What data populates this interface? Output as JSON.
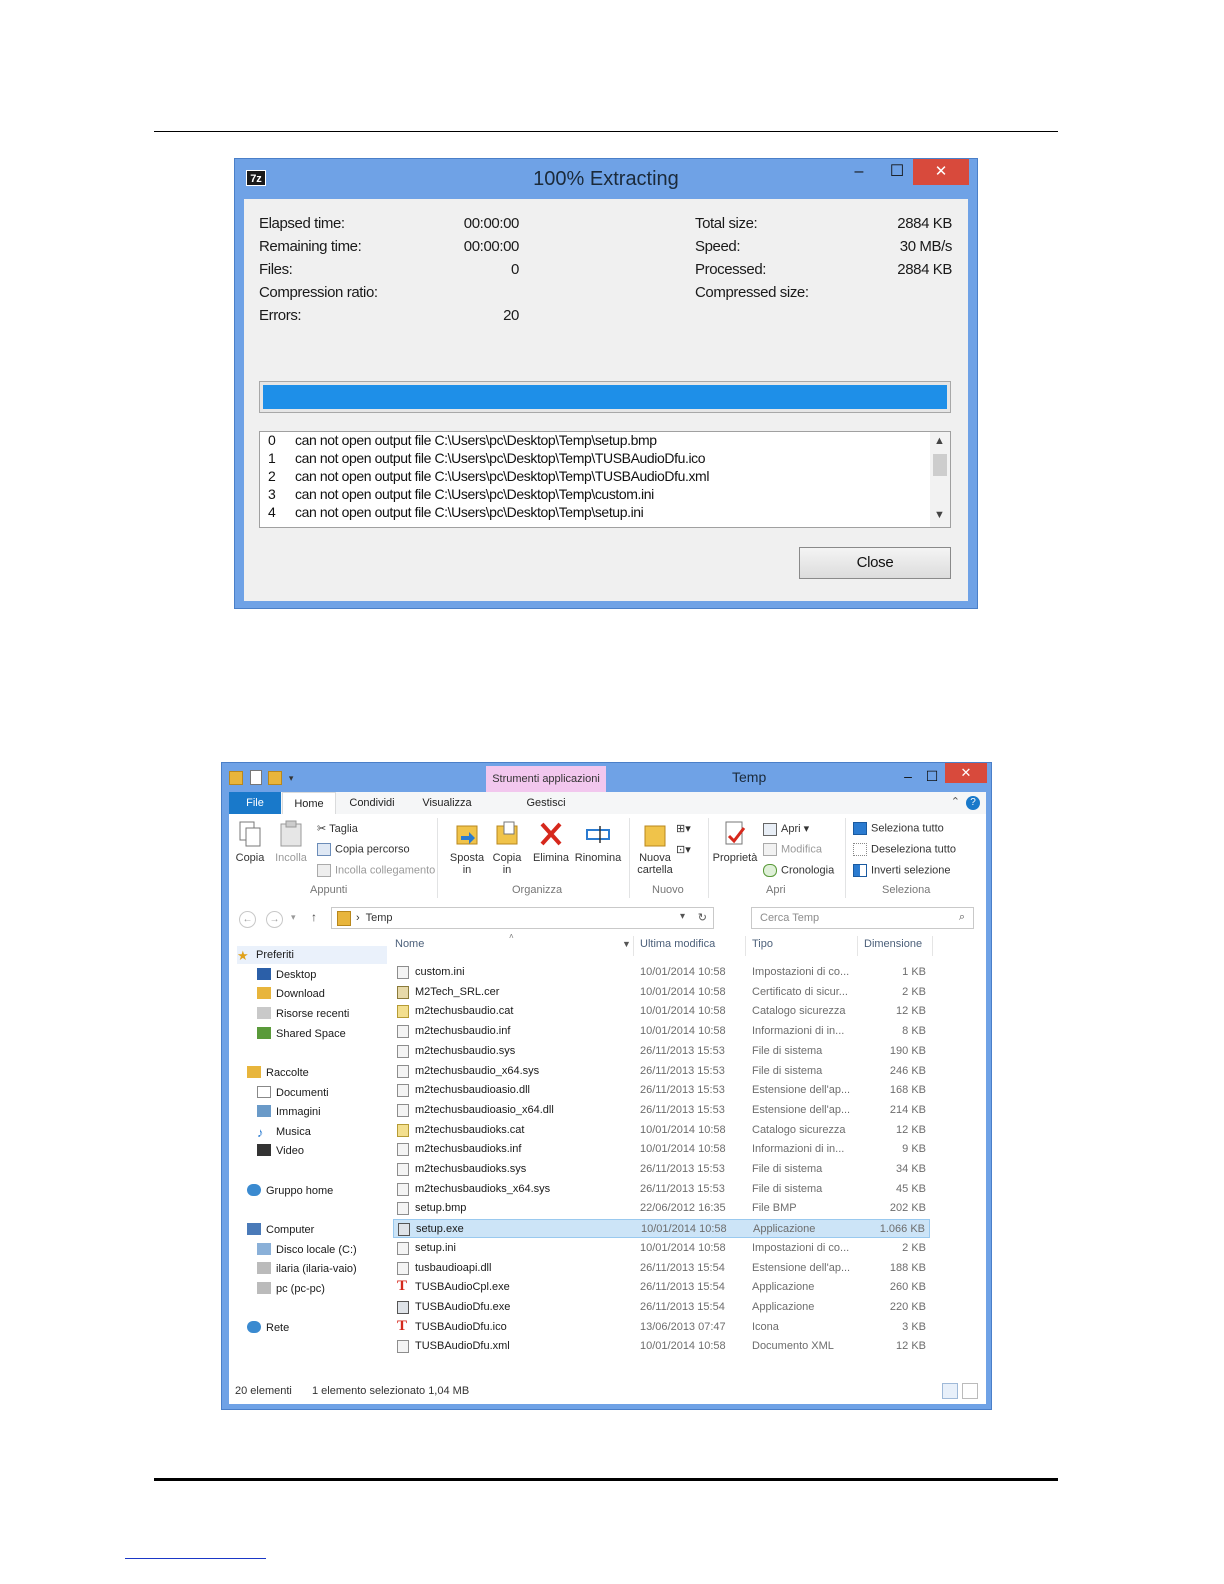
{
  "zip": {
    "icon_text": "7z",
    "title": "100% Extracting",
    "controls": {
      "minimize": "–",
      "maximize": "☐",
      "close": "✕"
    },
    "left_stats": [
      {
        "label": "Elapsed time:",
        "value": "00:00:00"
      },
      {
        "label": "Remaining time:",
        "value": "00:00:00"
      },
      {
        "label": "Files:",
        "value": "0"
      },
      {
        "label": "Compression ratio:",
        "value": ""
      },
      {
        "label": "Errors:",
        "value": "20"
      }
    ],
    "right_stats": [
      {
        "label": "Total size:",
        "value": "2884 KB"
      },
      {
        "label": "Speed:",
        "value": "30 MB/s"
      },
      {
        "label": "Processed:",
        "value": "2884 KB"
      },
      {
        "label": "Compressed size:",
        "value": ""
      }
    ],
    "progress_fraction": 1.0,
    "errors": [
      {
        "index": "0",
        "message": "can not open output file C:\\Users\\pc\\Desktop\\Temp\\setup.bmp"
      },
      {
        "index": "1",
        "message": "can not open output file C:\\Users\\pc\\Desktop\\Temp\\TUSBAudioDfu.ico"
      },
      {
        "index": "2",
        "message": "can not open output file C:\\Users\\pc\\Desktop\\Temp\\TUSBAudioDfu.xml"
      },
      {
        "index": "3",
        "message": "can not open output file C:\\Users\\pc\\Desktop\\Temp\\custom.ini"
      },
      {
        "index": "4",
        "message": "can not open output file C:\\Users\\pc\\Desktop\\Temp\\setup.ini"
      }
    ],
    "close_label": "Close"
  },
  "explorer": {
    "context_tab": "Strumenti applicazioni",
    "title": "Temp",
    "tabs": [
      "File",
      "Home",
      "Condividi",
      "Visualizza",
      "Gestisci"
    ],
    "ribbon": {
      "copia": "Copia",
      "incolla": "Incolla",
      "taglia": "Taglia",
      "copia_percorso": "Copia percorso",
      "incolla_collegamento": "Incolla collegamento",
      "group_appunti": "Appunti",
      "sposta_in": "Sposta in",
      "copia_in": "Copia in",
      "elimina": "Elimina",
      "rinomina": "Rinomina",
      "group_organizza": "Organizza",
      "nuova_cartella": "Nuova cartella",
      "group_nuovo": "Nuovo",
      "proprieta": "Proprietà",
      "apri": "Apri",
      "modifica": "Modifica",
      "cronologia": "Cronologia",
      "group_apri": "Apri",
      "seleziona_tutto": "Seleziona tutto",
      "deseleziona_tutto": "Deseleziona tutto",
      "inverti_selezione": "Inverti selezione",
      "group_seleziona": "Seleziona"
    },
    "address": "Temp",
    "search_placeholder": "Cerca Temp",
    "nav": {
      "preferiti": "Preferiti",
      "desktop": "Desktop",
      "download": "Download",
      "risorse_recenti": "Risorse recenti",
      "shared_space": "Shared Space",
      "raccolte": "Raccolte",
      "documenti": "Documenti",
      "immagini": "Immagini",
      "musica": "Musica",
      "video": "Video",
      "gruppo_home": "Gruppo home",
      "computer": "Computer",
      "disco_locale": "Disco locale (C:)",
      "ilaria": "ilaria (ilaria-vaio)",
      "pc": "pc (pc-pc)",
      "rete": "Rete"
    },
    "columns": {
      "name": "Nome",
      "modified": "Ultima modifica",
      "type": "Tipo",
      "size": "Dimensione"
    },
    "files": [
      {
        "name": "custom.ini",
        "modified": "10/01/2014 10:58",
        "type": "Impostazioni di co...",
        "size": "1 KB",
        "icon": "ini"
      },
      {
        "name": "M2Tech_SRL.cer",
        "modified": "10/01/2014 10:58",
        "type": "Certificato di sicur...",
        "size": "2 KB",
        "icon": "cer"
      },
      {
        "name": "m2techusbaudio.cat",
        "modified": "10/01/2014 10:58",
        "type": "Catalogo sicurezza",
        "size": "12 KB",
        "icon": "cat"
      },
      {
        "name": "m2techusbaudio.inf",
        "modified": "10/01/2014 10:58",
        "type": "Informazioni di in...",
        "size": "8 KB",
        "icon": "inf"
      },
      {
        "name": "m2techusbaudio.sys",
        "modified": "26/11/2013 15:53",
        "type": "File di sistema",
        "size": "190 KB",
        "icon": "sys"
      },
      {
        "name": "m2techusbaudio_x64.sys",
        "modified": "26/11/2013 15:53",
        "type": "File di sistema",
        "size": "246 KB",
        "icon": "sys"
      },
      {
        "name": "m2techusbaudioasio.dll",
        "modified": "26/11/2013 15:53",
        "type": "Estensione dell'ap...",
        "size": "168 KB",
        "icon": "dll"
      },
      {
        "name": "m2techusbaudioasio_x64.dll",
        "modified": "26/11/2013 15:53",
        "type": "Estensione dell'ap...",
        "size": "214 KB",
        "icon": "dll"
      },
      {
        "name": "m2techusbaudioks.cat",
        "modified": "10/01/2014 10:58",
        "type": "Catalogo sicurezza",
        "size": "12 KB",
        "icon": "cat"
      },
      {
        "name": "m2techusbaudioks.inf",
        "modified": "10/01/2014 10:58",
        "type": "Informazioni di in...",
        "size": "9 KB",
        "icon": "inf"
      },
      {
        "name": "m2techusbaudioks.sys",
        "modified": "26/11/2013 15:53",
        "type": "File di sistema",
        "size": "34 KB",
        "icon": "sys"
      },
      {
        "name": "m2techusbaudioks_x64.sys",
        "modified": "26/11/2013 15:53",
        "type": "File di sistema",
        "size": "45 KB",
        "icon": "sys"
      },
      {
        "name": "setup.bmp",
        "modified": "22/06/2012 16:35",
        "type": "File BMP",
        "size": "202 KB",
        "icon": "bmp"
      },
      {
        "name": "setup.exe",
        "modified": "10/01/2014 10:58",
        "type": "Applicazione",
        "size": "1.066 KB",
        "icon": "exe",
        "selected": true
      },
      {
        "name": "setup.ini",
        "modified": "10/01/2014 10:58",
        "type": "Impostazioni di co...",
        "size": "2 KB",
        "icon": "ini"
      },
      {
        "name": "tusbaudioapi.dll",
        "modified": "26/11/2013 15:54",
        "type": "Estensione dell'ap...",
        "size": "188 KB",
        "icon": "dll"
      },
      {
        "name": "TUSBAudioCpl.exe",
        "modified": "26/11/2013 15:54",
        "type": "Applicazione",
        "size": "260 KB",
        "icon": "t"
      },
      {
        "name": "TUSBAudioDfu.exe",
        "modified": "26/11/2013 15:54",
        "type": "Applicazione",
        "size": "220 KB",
        "icon": "exe"
      },
      {
        "name": "TUSBAudioDfu.ico",
        "modified": "13/06/2013 07:47",
        "type": "Icona",
        "size": "3 KB",
        "icon": "t"
      },
      {
        "name": "TUSBAudioDfu.xml",
        "modified": "10/01/2014 10:58",
        "type": "Documento XML",
        "size": "12 KB",
        "icon": "xml"
      }
    ],
    "status": {
      "count": "20 elementi",
      "selection": "1 elemento selezionato  1,04 MB"
    }
  }
}
